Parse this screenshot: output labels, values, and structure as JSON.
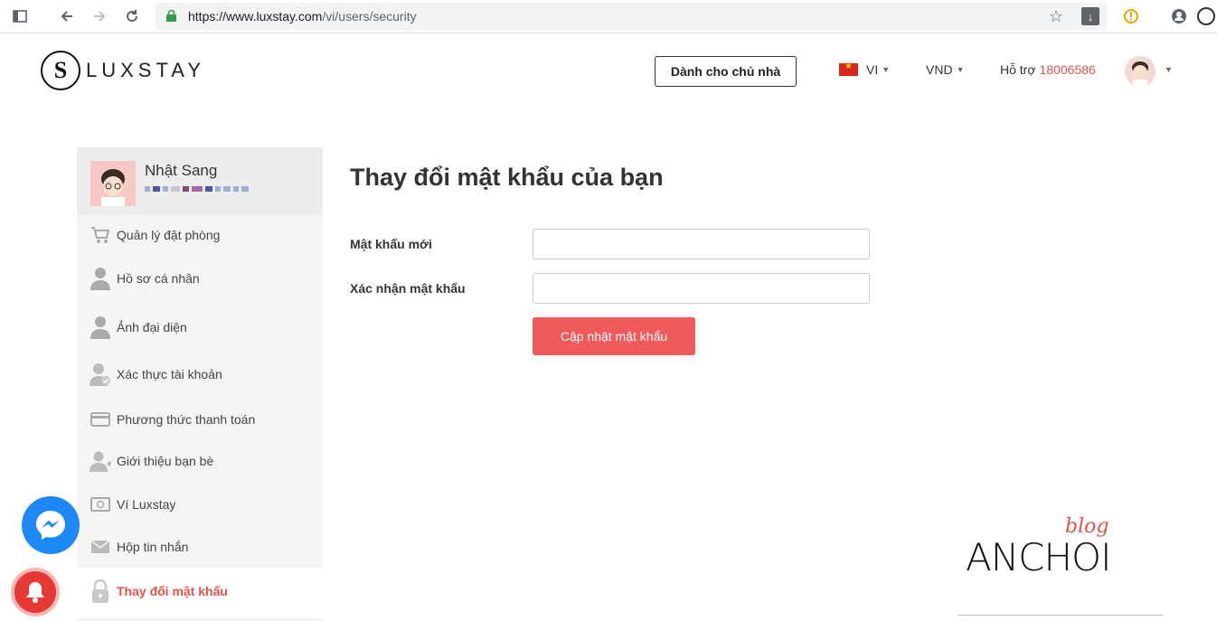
{
  "browser": {
    "url_host": "https://www.luxstay.com",
    "url_path": "/vi/users/security"
  },
  "header": {
    "logo_mark": "S",
    "logo_text": "LUXSTAY",
    "host_button": "Dành cho chủ nhà",
    "language": "VI",
    "currency": "VND",
    "support_label": "Hỗ trợ",
    "support_phone": "18006586"
  },
  "sidebar": {
    "user_name": "Nhật Sang",
    "items": [
      {
        "label": "Quản lý đặt phòng",
        "icon": "cart-icon"
      },
      {
        "label": "Hồ sơ cá nhân",
        "icon": "user-icon"
      },
      {
        "label": "Ảnh đại diện",
        "icon": "user-icon"
      },
      {
        "label": "Xác thực tài khoản",
        "icon": "user-check-icon"
      },
      {
        "label": "Phương thức thanh toán",
        "icon": "credit-card-icon"
      },
      {
        "label": "Giới thiệu bạn bè",
        "icon": "user-plus-icon"
      },
      {
        "label": "Ví Luxstay",
        "icon": "wallet-icon"
      },
      {
        "label": "Hộp tin nhắn",
        "icon": "envelope-icon"
      },
      {
        "label": "Thay đổi mật khẩu",
        "icon": "lock-icon",
        "active": true
      }
    ]
  },
  "main": {
    "title": "Thay đổi mật khẩu của bạn",
    "new_password_label": "Mật khẩu mới",
    "new_password_value": "",
    "confirm_password_label": "Xác nhận mật khẩu",
    "confirm_password_value": "",
    "submit_label": "Cập nhật mật khẩu"
  },
  "watermark": {
    "main": "ANCHOI",
    "small": "blog"
  },
  "colors": {
    "accent": "#f05a5a",
    "active_text": "#e5534b",
    "messenger": "#1e88f5"
  }
}
